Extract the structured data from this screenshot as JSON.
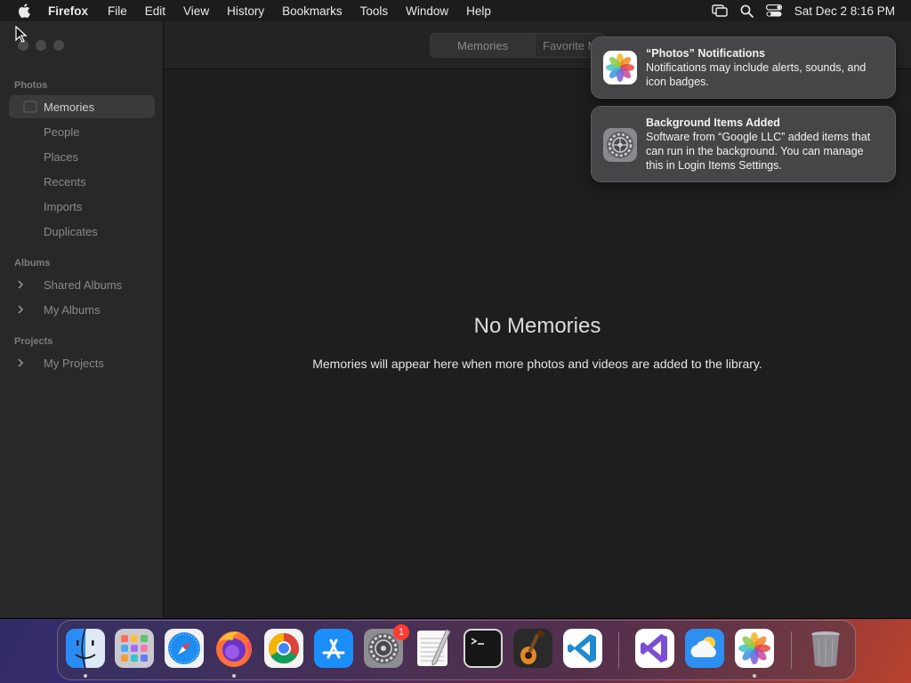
{
  "menubar": {
    "app_name": "Firefox",
    "items": [
      "File",
      "Edit",
      "View",
      "History",
      "Bookmarks",
      "Tools",
      "Window",
      "Help"
    ],
    "clock": "Sat Dec 2  8:16 PM"
  },
  "sidebar": {
    "photos_header": "Photos",
    "photos_items": [
      "Memories",
      "People",
      "Places",
      "Recents",
      "Imports",
      "Duplicates"
    ],
    "selected": "Memories",
    "albums_header": "Albums",
    "album_items": [
      "Shared Albums",
      "My Albums"
    ],
    "projects_header": "Projects",
    "project_items": [
      "My Projects"
    ]
  },
  "toolbar": {
    "tabs": [
      "Memories",
      "Favorite M"
    ]
  },
  "content": {
    "empty_title": "No Memories",
    "empty_subtitle": "Memories will appear here when more photos and videos are added to the library."
  },
  "notifications": [
    {
      "title": "“Photos” Notifications",
      "body": "Notifications may include alerts, sounds, and icon badges.",
      "icon": "photos-icon"
    },
    {
      "title": "Background Items Added",
      "body": "Software from “Google LLC” added items that can run in the background. You can manage this in Login Items Settings.",
      "icon": "system-settings-icon"
    }
  ],
  "dock": {
    "items": [
      "Finder",
      "Launchpad",
      "Safari",
      "Firefox",
      "Chrome",
      "App Store",
      "System Settings",
      "TextEdit",
      "Terminal",
      "GarageBand",
      "VS Code",
      "Visual Studio",
      "Weather",
      "Photos",
      "Trash"
    ],
    "settings_badge": "1"
  }
}
